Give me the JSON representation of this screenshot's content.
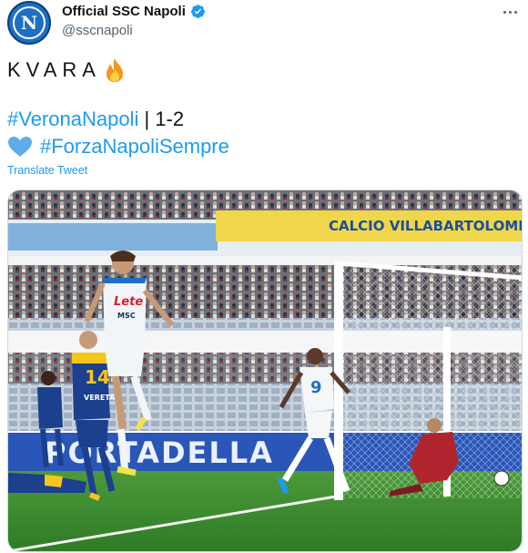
{
  "header": {
    "display_name": "Official SSC Napoli",
    "handle": "@sscnapoli",
    "avatar_letter": "N"
  },
  "tweet": {
    "line1": "KVARA",
    "line2_hashtag": "#VeronaNapoli",
    "line2_text": " | 1-2",
    "line3_hashtag": "#ForzaNapoliSempre",
    "translate_label": "Translate Tweet"
  },
  "media": {
    "banner_text": "CALCIO VILLABARTOLOMEO",
    "board_text": "PORTADELLA",
    "player_a_sponsor": "Lete",
    "player_a_sponsor2": "MSC",
    "player_b_number": "14",
    "player_b_sponsor": "VERETA",
    "player_c_number": "9"
  },
  "colors": {
    "link": "#1d9bf0",
    "napoli_blue": "#1e6fc4",
    "verona_yellow": "#f4c61c",
    "pitch_green": "#3d8a2f"
  }
}
